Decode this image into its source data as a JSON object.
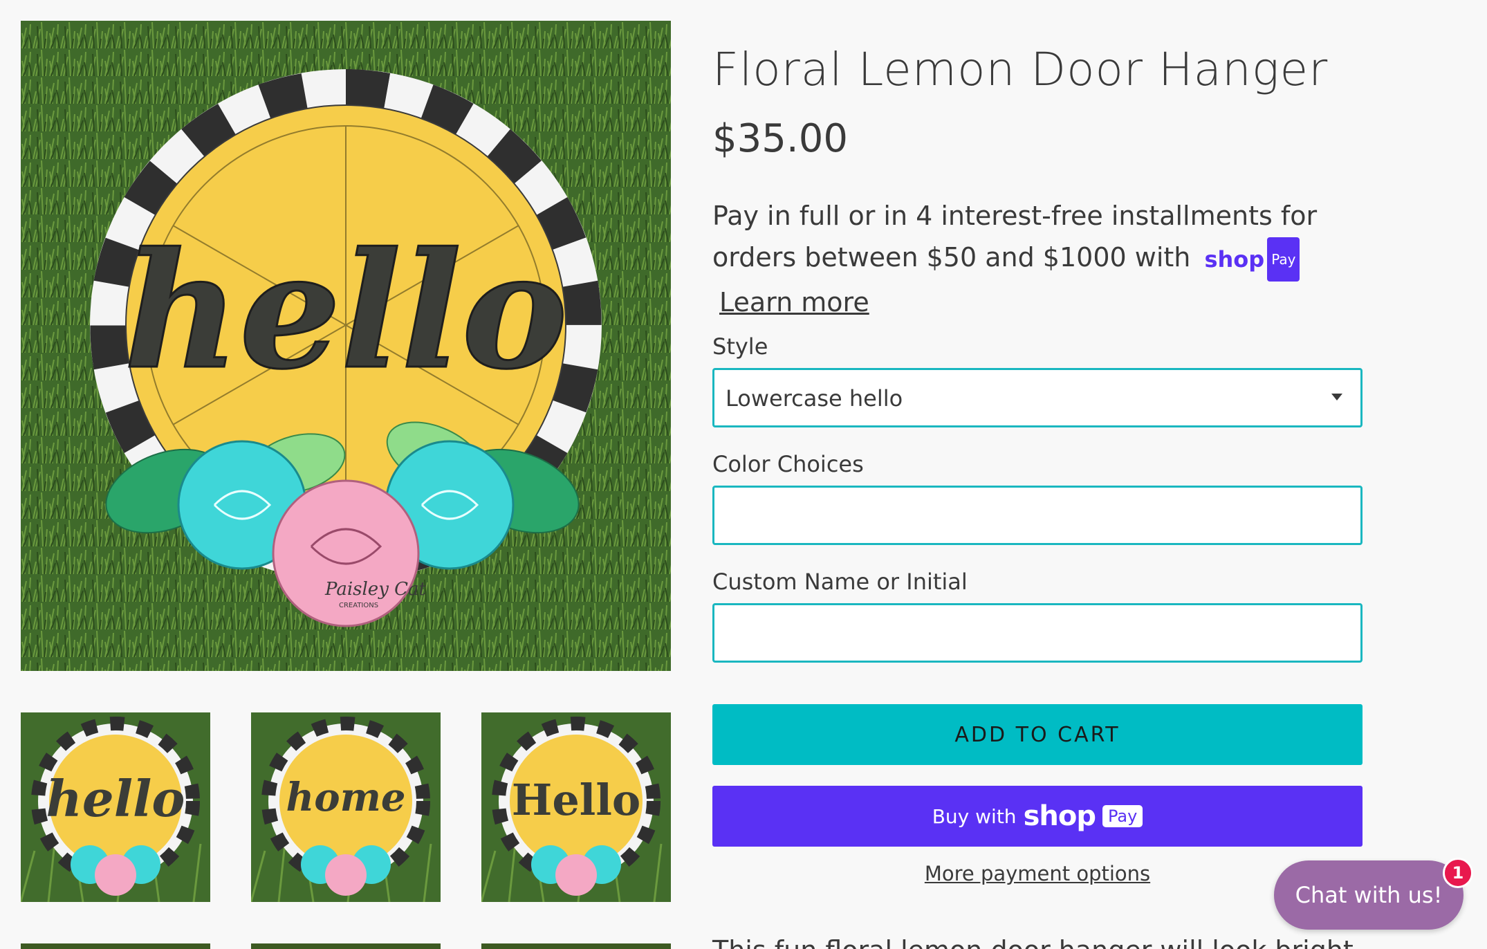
{
  "product": {
    "title": "Floral Lemon Door Hanger",
    "price": "$35.00",
    "installments_text_1": "Pay in full or in 4 interest-free installments for orders between $50 and $1000 with",
    "shop_pay_word": "shop",
    "shop_pay_badge": "Pay",
    "learn_more": "Learn more"
  },
  "gallery": {
    "main_image": {
      "word": "hello",
      "watermark": "Paisley Cat",
      "watermark_sub": "CREATIONS"
    },
    "thumbnails": [
      {
        "word": "hello"
      },
      {
        "word": "home"
      },
      {
        "word": "Hello"
      }
    ]
  },
  "form": {
    "style_label": "Style",
    "style_value": "Lowercase hello",
    "color_label": "Color Choices",
    "color_value": "",
    "custom_label": "Custom Name or Initial",
    "custom_value": ""
  },
  "buttons": {
    "add_to_cart": "ADD TO CART",
    "buy_with": "Buy with",
    "buy_shop": "shop",
    "buy_pay": "Pay",
    "more_payment": "More payment options"
  },
  "description_partial": "This fun floral lemon door hanger will look bright",
  "chat": {
    "label": "Chat with us!",
    "badge_count": "1"
  },
  "colors": {
    "accent_teal": "#00bcc4",
    "shop_pay_purple": "#5a31f4",
    "chat_purple": "#9b6aa6",
    "badge_red": "#e8184d"
  }
}
